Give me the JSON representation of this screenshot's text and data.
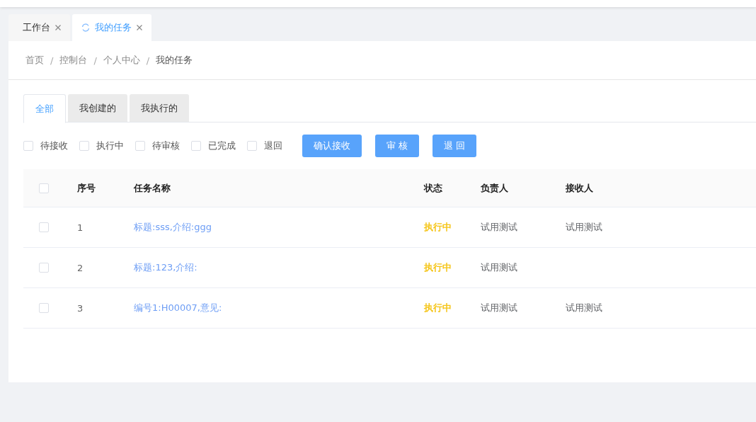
{
  "page_tabs": [
    {
      "label": "工作台",
      "selected": false
    },
    {
      "label": "我的任务",
      "selected": true
    }
  ],
  "breadcrumb": [
    {
      "label": "首页"
    },
    {
      "separator": "/",
      "label": "控制台"
    },
    {
      "separator": "/",
      "label": "个人中心"
    },
    {
      "separator": "/",
      "label": "我的任务"
    }
  ],
  "tabs": [
    {
      "label": "全部",
      "selected": true
    },
    {
      "label": "我创建的",
      "selected": false
    },
    {
      "label": "我执行的",
      "selected": false
    }
  ],
  "filters": [
    {
      "label": "待接收",
      "checked": false
    },
    {
      "label": "执行中",
      "checked": false
    },
    {
      "label": "待审核",
      "checked": false
    },
    {
      "label": "已完成",
      "checked": false
    },
    {
      "label": "退回",
      "checked": false
    }
  ],
  "buttons": [
    "确认接收",
    "审 核",
    "退 回"
  ],
  "table": {
    "select_all_checked": false,
    "columns": [
      "序号",
      "任务名称",
      "状态",
      "负责人",
      "接收人"
    ],
    "rows": [
      {
        "checked": false,
        "index": "1",
        "name": "标题:sss,介绍:ggg",
        "status": "执行中",
        "owner": "试用测试",
        "receiver": "试用测试"
      },
      {
        "checked": false,
        "index": "2",
        "name": "标题:123,介绍:",
        "status": "执行中",
        "owner": "试用测试"
      },
      {
        "checked": false,
        "index": "3",
        "name": "编号1:H00007,意见:",
        "status": "执行中",
        "owner": "试用测试",
        "receiver": "试用测试"
      }
    ]
  }
}
